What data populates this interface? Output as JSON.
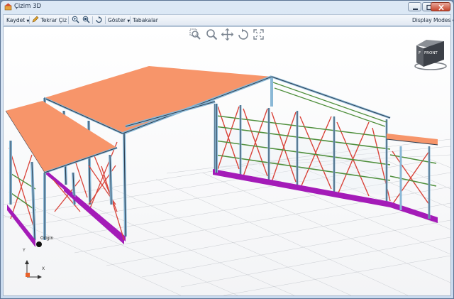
{
  "window": {
    "title": "Çizim 3D",
    "title_color": "#1e2f45"
  },
  "toolbar": {
    "save_label": "Kaydet",
    "redraw_label": "Tekrar Çiz",
    "show_label": "Göster",
    "layers_label": "Tabakalar",
    "display_modes_label": "Display Modes"
  },
  "viewcube": {
    "front_label": "FRONT",
    "side_label": "F"
  },
  "axes": {
    "y_label": "Y",
    "x_label": "X",
    "origin_label": "Origin"
  },
  "colors": {
    "roof": "#f7956a",
    "column": "#8ab8d6",
    "bracing": "#d9443a",
    "purlin": "#4f8f3c",
    "base": "#a41bb8"
  }
}
